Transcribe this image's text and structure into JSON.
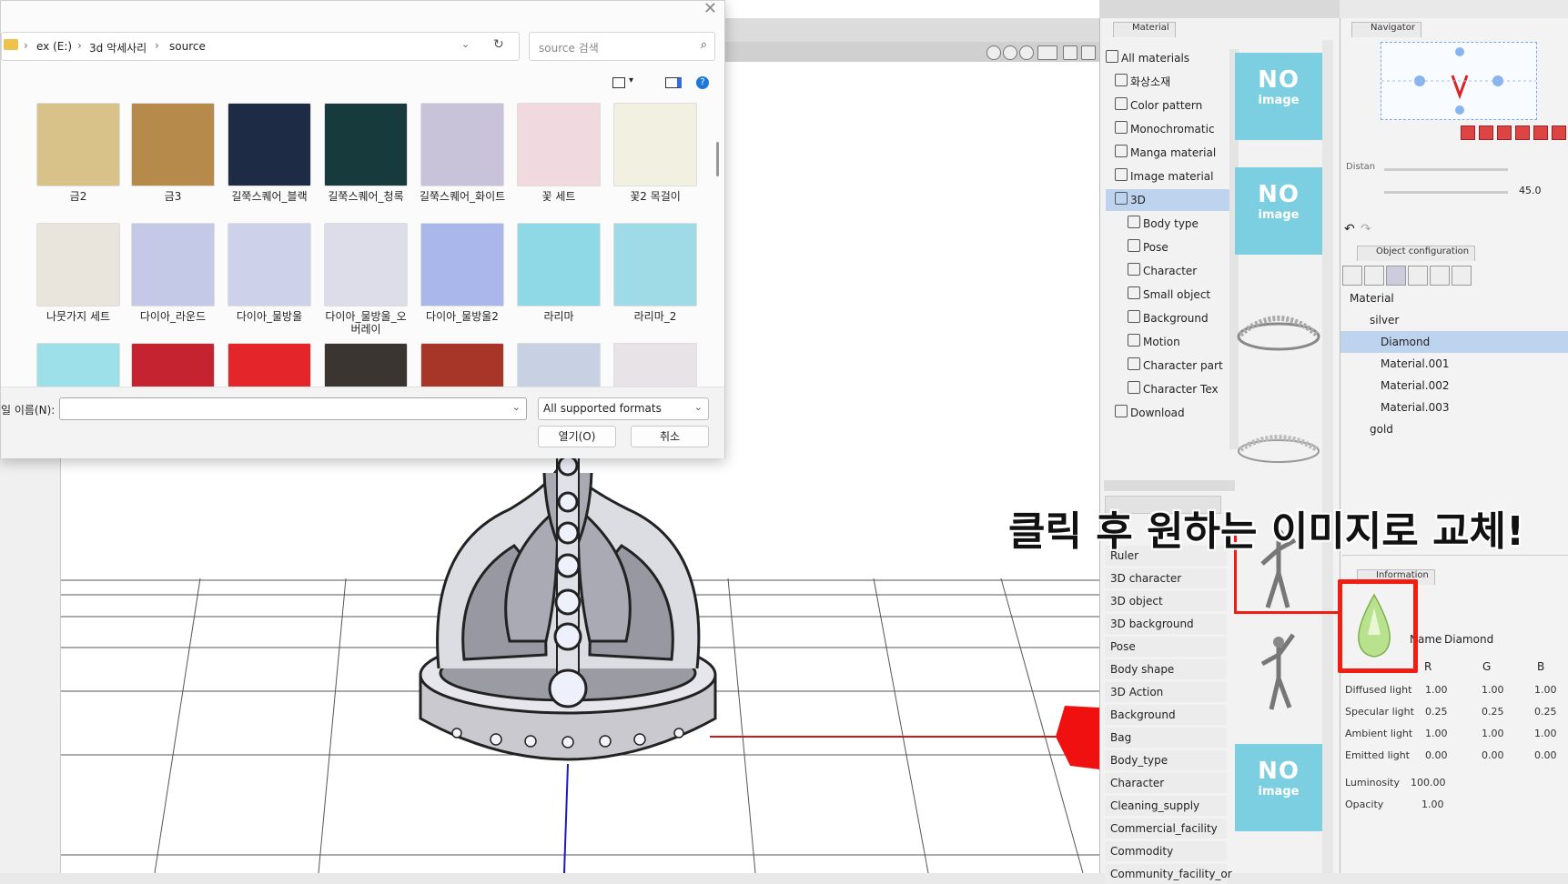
{
  "dialog": {
    "address": {
      "crumbs": [
        "ex (E:)",
        "3d 악세사리",
        "source"
      ],
      "separator": "›"
    },
    "search": {
      "placeholder": "source 검색"
    },
    "grid": [
      {
        "label": "금2",
        "color": "#d9c28a"
      },
      {
        "label": "금3",
        "color": "#b58a4a"
      },
      {
        "label": "길쭉스퀘어_블랙",
        "color": "#1e2b45"
      },
      {
        "label": "길쭉스퀘어_청록",
        "color": "#173a3c"
      },
      {
        "label": "길쭉스퀘어_화이트",
        "color": "#c9c3da"
      },
      {
        "label": "꽃 세트",
        "color": "#f1dadf"
      },
      {
        "label": "꽃2 목걸이",
        "color": "#f2f0e0"
      },
      {
        "label": "나뭇가지 세트",
        "color": "#e9e4dc"
      },
      {
        "label": "다이아_라운드",
        "color": "#c3c9e7"
      },
      {
        "label": "다이아_물방울",
        "color": "#cdd1e9"
      },
      {
        "label": "다이아_물방울_오버레이",
        "color": "#dcdde9"
      },
      {
        "label": "다이아_물방울2",
        "color": "#a9b7ea"
      },
      {
        "label": "라리마",
        "color": "#8fd8e6"
      },
      {
        "label": "라리마_2",
        "color": "#9fdbe7"
      },
      {
        "label": "",
        "color": "#9ee0ea"
      },
      {
        "label": "",
        "color": "#c4232f"
      },
      {
        "label": "",
        "color": "#e4262a"
      },
      {
        "label": "",
        "color": "#3a3530"
      },
      {
        "label": "",
        "color": "#a83628"
      },
      {
        "label": "",
        "color": "#c8d1e3"
      },
      {
        "label": "",
        "color": "#e8e3e6"
      }
    ],
    "filename_label": "일 이름(N):",
    "filename_value": "",
    "filetype": "All supported formats",
    "open_button": "열기(O)",
    "cancel_button": "취소"
  },
  "material_panel": {
    "tab": "Material",
    "tree": [
      {
        "label": "All materials"
      },
      {
        "label": "화상소재"
      },
      {
        "label": "Color pattern"
      },
      {
        "label": "Monochromatic"
      },
      {
        "label": "Manga material"
      },
      {
        "label": "Image material"
      },
      {
        "label": "3D",
        "selected": true
      },
      {
        "label": "Body type"
      },
      {
        "label": "Pose"
      },
      {
        "label": "Character"
      },
      {
        "label": "Small object"
      },
      {
        "label": "Background"
      },
      {
        "label": "Motion"
      },
      {
        "label": "Character part"
      },
      {
        "label": "Character Tex"
      },
      {
        "label": "Download"
      }
    ],
    "noimage": {
      "big": "NO",
      "small": "image"
    },
    "tag_list": [
      "Ruler",
      "3D character",
      "3D object",
      "3D background",
      "Pose",
      "Body shape",
      "3D Action",
      "Background",
      "Bag",
      "Body_type",
      "Character",
      "Cleaning_supply",
      "Commercial_facility",
      "Commodity",
      "Community_facility_or"
    ]
  },
  "navigator": {
    "tab": "Navigator",
    "distance_label": "Distan",
    "angle_value": "45.0"
  },
  "object_config": {
    "tab": "Object configuration",
    "items": [
      {
        "label": "Material"
      },
      {
        "label": "silver"
      },
      {
        "label": "Diamond",
        "selected": true
      },
      {
        "label": "Material.001"
      },
      {
        "label": "Material.002"
      },
      {
        "label": "Material.003"
      },
      {
        "label": "gold"
      }
    ]
  },
  "information": {
    "tab": "Information",
    "name_label": "Name",
    "name_value": "Diamond",
    "col_headers": [
      "R",
      "G",
      "B"
    ],
    "rows": [
      {
        "label": "Diffused light",
        "r": "1.00",
        "g": "1.00",
        "b": "1.00"
      },
      {
        "label": "Specular light",
        "r": "0.25",
        "g": "0.25",
        "b": "0.25"
      },
      {
        "label": "Ambient light",
        "r": "1.00",
        "g": "1.00",
        "b": "1.00"
      },
      {
        "label": "Emitted light",
        "r": "0.00",
        "g": "0.00",
        "b": "0.00"
      }
    ],
    "luminosity_label": "Luminosity",
    "luminosity_value": "100.00",
    "opacity_label": "Opacity",
    "opacity_value": "1.00"
  },
  "annotation": "클릭 후 원하는 이미지로 교체!",
  "colors": {
    "highlight": "#f21d12",
    "selection": "#bdd3ee",
    "noimage": "#7ccfe0",
    "axis_x": "#c81a1a",
    "axis_y": "#1a1ac8",
    "gizmo": "#f01010"
  }
}
